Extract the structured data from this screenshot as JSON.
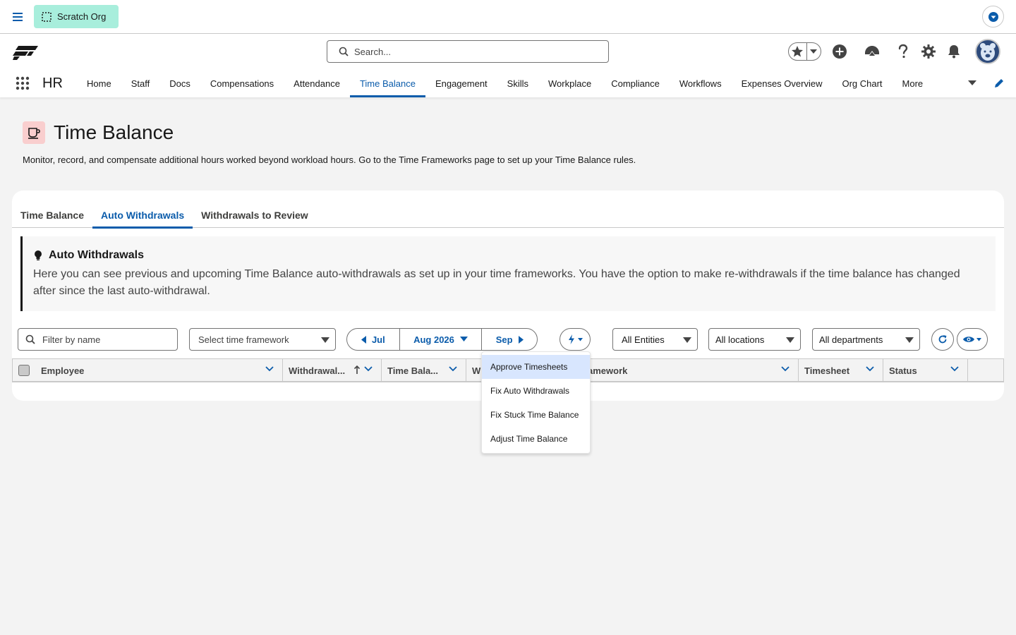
{
  "topbar": {
    "org_label": "Scratch Org"
  },
  "header": {
    "search_placeholder": "Search..."
  },
  "nav": {
    "app_name": "HR",
    "items": [
      "Home",
      "Staff",
      "Docs",
      "Compensations",
      "Attendance",
      "Time Balance",
      "Engagement",
      "Skills",
      "Workplace",
      "Compliance",
      "Workflows",
      "Expenses Overview",
      "Org Chart",
      "More"
    ],
    "active": "Time Balance"
  },
  "page": {
    "title": "Time Balance",
    "description": "Monitor, record, and compensate additional hours worked beyond workload hours. Go to the Time Frameworks page to set up your Time Balance rules."
  },
  "tabs": [
    "Time Balance",
    "Auto Withdrawals",
    "Withdrawals to Review"
  ],
  "info": {
    "title": "Auto Withdrawals",
    "text": "Here you can see previous and upcoming Time Balance auto-withdrawals as set up in your time frameworks. You have the option to make re-withdrawals if the time balance has changed after since the last auto-withdrawal."
  },
  "filters": {
    "name_placeholder": "Filter by name",
    "framework_placeholder": "Select time framework",
    "prev_month": "Jul",
    "current_month": "Aug 2026",
    "next_month": "Sep",
    "entities": "All Entities",
    "locations": "All locations",
    "departments": "All departments"
  },
  "table": {
    "columns": [
      "Employee",
      "Withdrawal...",
      "Time Bala...",
      "W",
      "amework",
      "Timesheet",
      "Status"
    ]
  },
  "menu": {
    "items": [
      "Approve Timesheets",
      "Fix Auto Withdrawals",
      "Fix Stuck Time Balance",
      "Adjust Time Balance"
    ]
  },
  "colors": {
    "brand": "#0b5cab",
    "org_badge": "#a8eedc",
    "page_icon_bg": "#f9cece"
  }
}
